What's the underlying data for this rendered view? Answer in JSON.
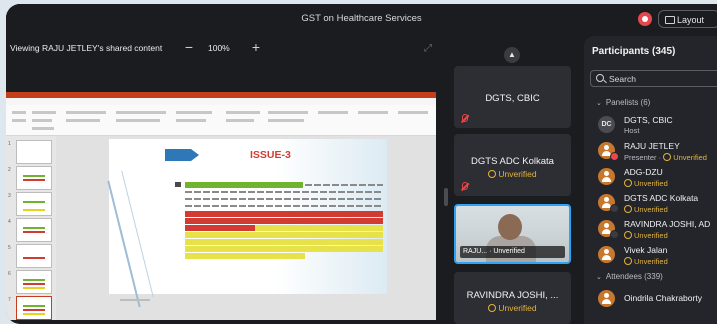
{
  "window": {
    "title": "GST on Healthcare Services",
    "layout_label": "Layout"
  },
  "viewbar": {
    "viewing_text": "Viewing RAJU JETLEY's shared content",
    "zoom_minus": "−",
    "zoom_value": "100%",
    "zoom_plus": "+"
  },
  "slide": {
    "title": "ISSUE-3",
    "body_fragments": [
      "Health care services",
      "provided by the clinical establishments will include food",
      "supplied to the patients; but such food may be",
      "prepared by the canteens run by the hospitals or may",
      "hospitals have their own canteens and",
      "prepare their own food, then no ITC will be available on",
      "inputs including capital goods and in case if these supply",
      "food to the doctors and their staff, such supplies, even",
      "when not charged, may be subjected to GST."
    ]
  },
  "tiles": [
    {
      "name": "DGTS, CBIC",
      "status": ""
    },
    {
      "name": "DGTS ADC Kolkata",
      "status": "Unverified"
    },
    {
      "name": "RAJU...",
      "status": "Unverified"
    },
    {
      "name": "RAVINDRA JOSHI, ...",
      "status": "Unverified"
    }
  ],
  "participants": {
    "title": "Participants (345)",
    "search_placeholder": "Search",
    "panelists_label": "Panelists (6)",
    "attendees_label": "Attendees (339)",
    "panelists": [
      {
        "initials": "DC",
        "name": "DGTS, CBIC",
        "role": "Host",
        "unverified": ""
      },
      {
        "initials": "",
        "name": "RAJU JETLEY",
        "role": "Presenter · ",
        "unverified": "Unverified"
      },
      {
        "initials": "",
        "name": "ADG-DZU",
        "role": "",
        "unverified": "Unverified"
      },
      {
        "initials": "",
        "name": "DGTS ADC Kolkata",
        "role": "",
        "unverified": "Unverified"
      },
      {
        "initials": "",
        "name": "RAVINDRA JOSHI, AD",
        "role": "",
        "unverified": "Unverified"
      },
      {
        "initials": "",
        "name": "Vivek Jalan",
        "role": "",
        "unverified": "Unverified"
      }
    ],
    "attendees": [
      {
        "name": "Oindrila Chakraborty"
      }
    ]
  }
}
